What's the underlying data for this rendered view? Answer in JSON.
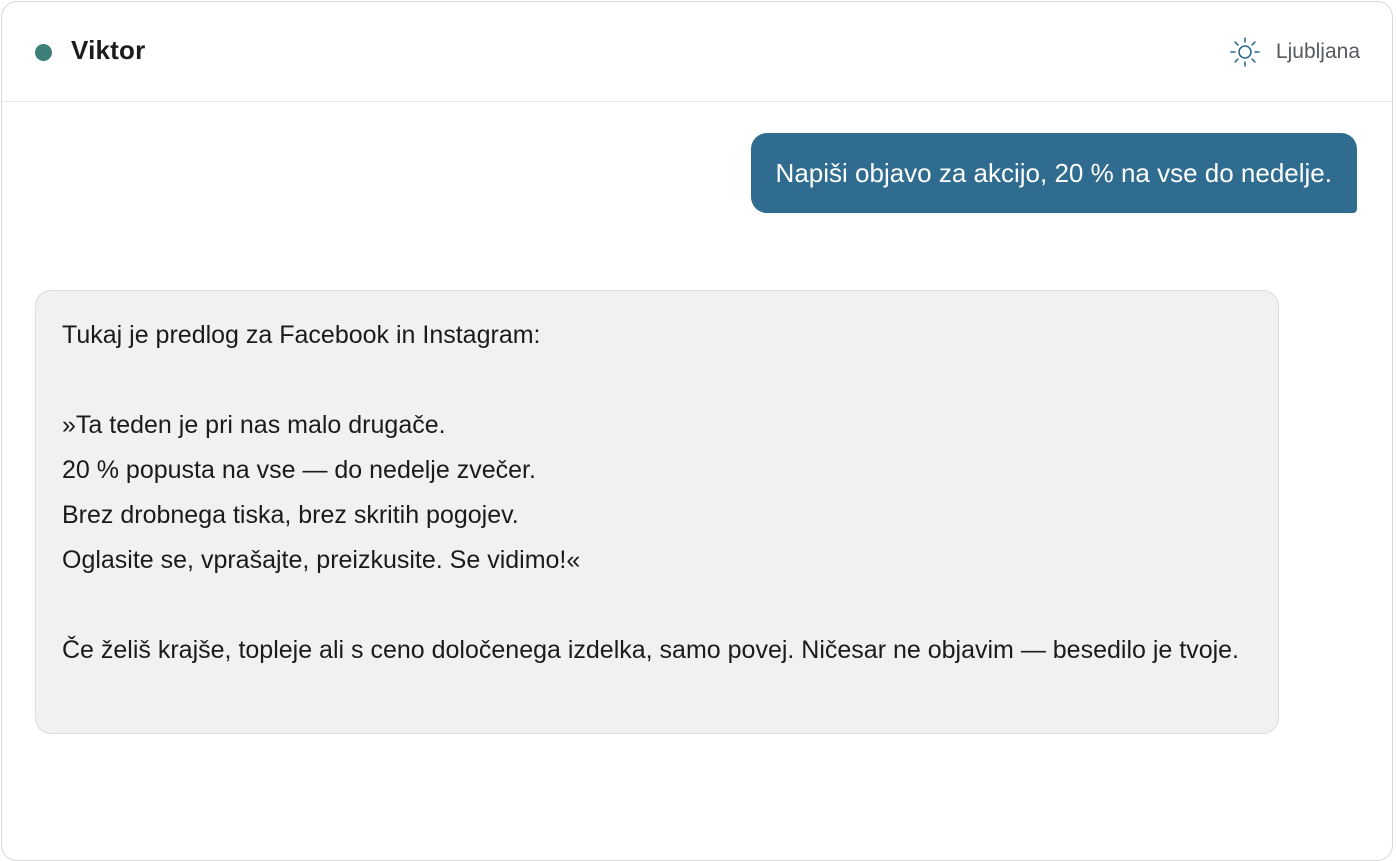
{
  "header": {
    "contact_name": "Viktor",
    "status_color": "#3f7f7a",
    "weather": {
      "icon": "sun-icon",
      "location": "Ljubljana"
    }
  },
  "messages": {
    "user": {
      "text": "Napiši objavo za akcijo, 20 % na vse do nedelje.",
      "color": "#2f6c90"
    },
    "assistant": {
      "intro": "Tukaj je predlog za Facebook in Instagram:",
      "post_lines": [
        "»Ta teden je pri nas malo drugače.",
        "20 % popusta na vse — do nedelje zvečer.",
        "Brez drobnega tiska, brez skritih pogojev.",
        "Oglasite se, vprašajte, preizkusite. Se vidimo!«"
      ],
      "outro": "Če želiš krajše, topleje ali s ceno določenega izdelka, samo povej. Ničesar ne objavim — besedilo je tvoje.",
      "background": "#f1f1ef"
    }
  }
}
